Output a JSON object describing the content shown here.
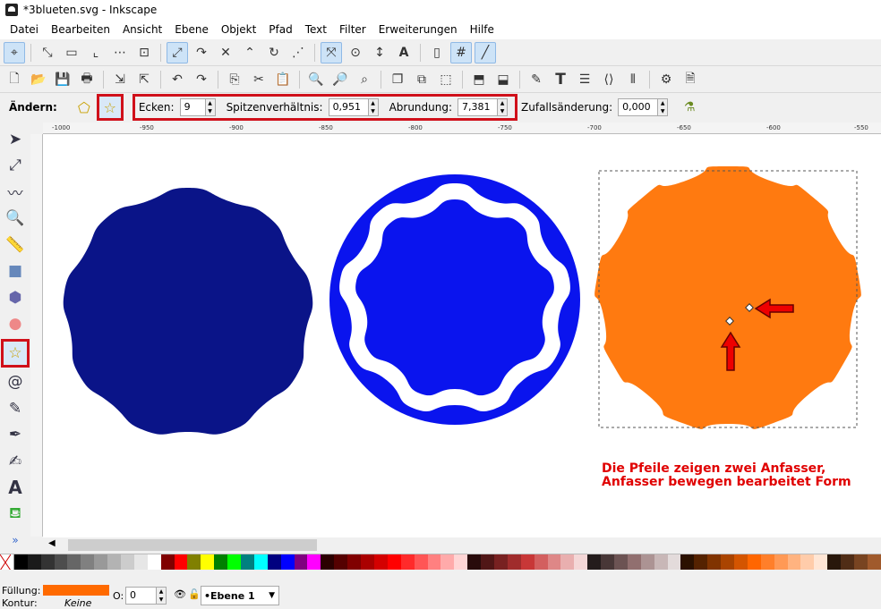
{
  "window": {
    "title": "*3blueten.svg - Inkscape"
  },
  "menu": [
    {
      "label": "Datei"
    },
    {
      "label": "Bearbeiten"
    },
    {
      "label": "Ansicht"
    },
    {
      "label": "Ebene"
    },
    {
      "label": "Objekt"
    },
    {
      "label": "Pfad"
    },
    {
      "label": "Text"
    },
    {
      "label": "Filter"
    },
    {
      "label": "Erweiterungen"
    },
    {
      "label": "Hilfe"
    }
  ],
  "controls": {
    "change_label": "Ändern:",
    "corners_label": "Ecken:",
    "corners_value": "9",
    "spoke_label": "Spitzenverhältnis:",
    "spoke_value": "0,951",
    "round_label": "Abrundung:",
    "round_value": "7,381",
    "random_label": "Zufallsänderung:",
    "random_value": "0,000"
  },
  "ruler_ticks": [
    "-1000",
    "-950",
    "-900",
    "-850",
    "-800",
    "-750",
    "-700",
    "-650",
    "-600",
    "-550"
  ],
  "annotation": {
    "line1": "Die Pfeile zeigen zwei Anfasser,",
    "line2": "Anfasser bewegen bearbeitet Form"
  },
  "status": {
    "fill_label": "Füllung:",
    "stroke_label": "Kontur:",
    "stroke_value": "Keine",
    "opacity_label": "O:",
    "opacity_value": "0",
    "layer_value": "•Ebene 1"
  },
  "colors": {
    "navy": "#0a1488",
    "blue": "#0a14ee",
    "orange": "#ff7a10",
    "red": "#d0101a",
    "fill_swatch": "#ff6a00"
  }
}
